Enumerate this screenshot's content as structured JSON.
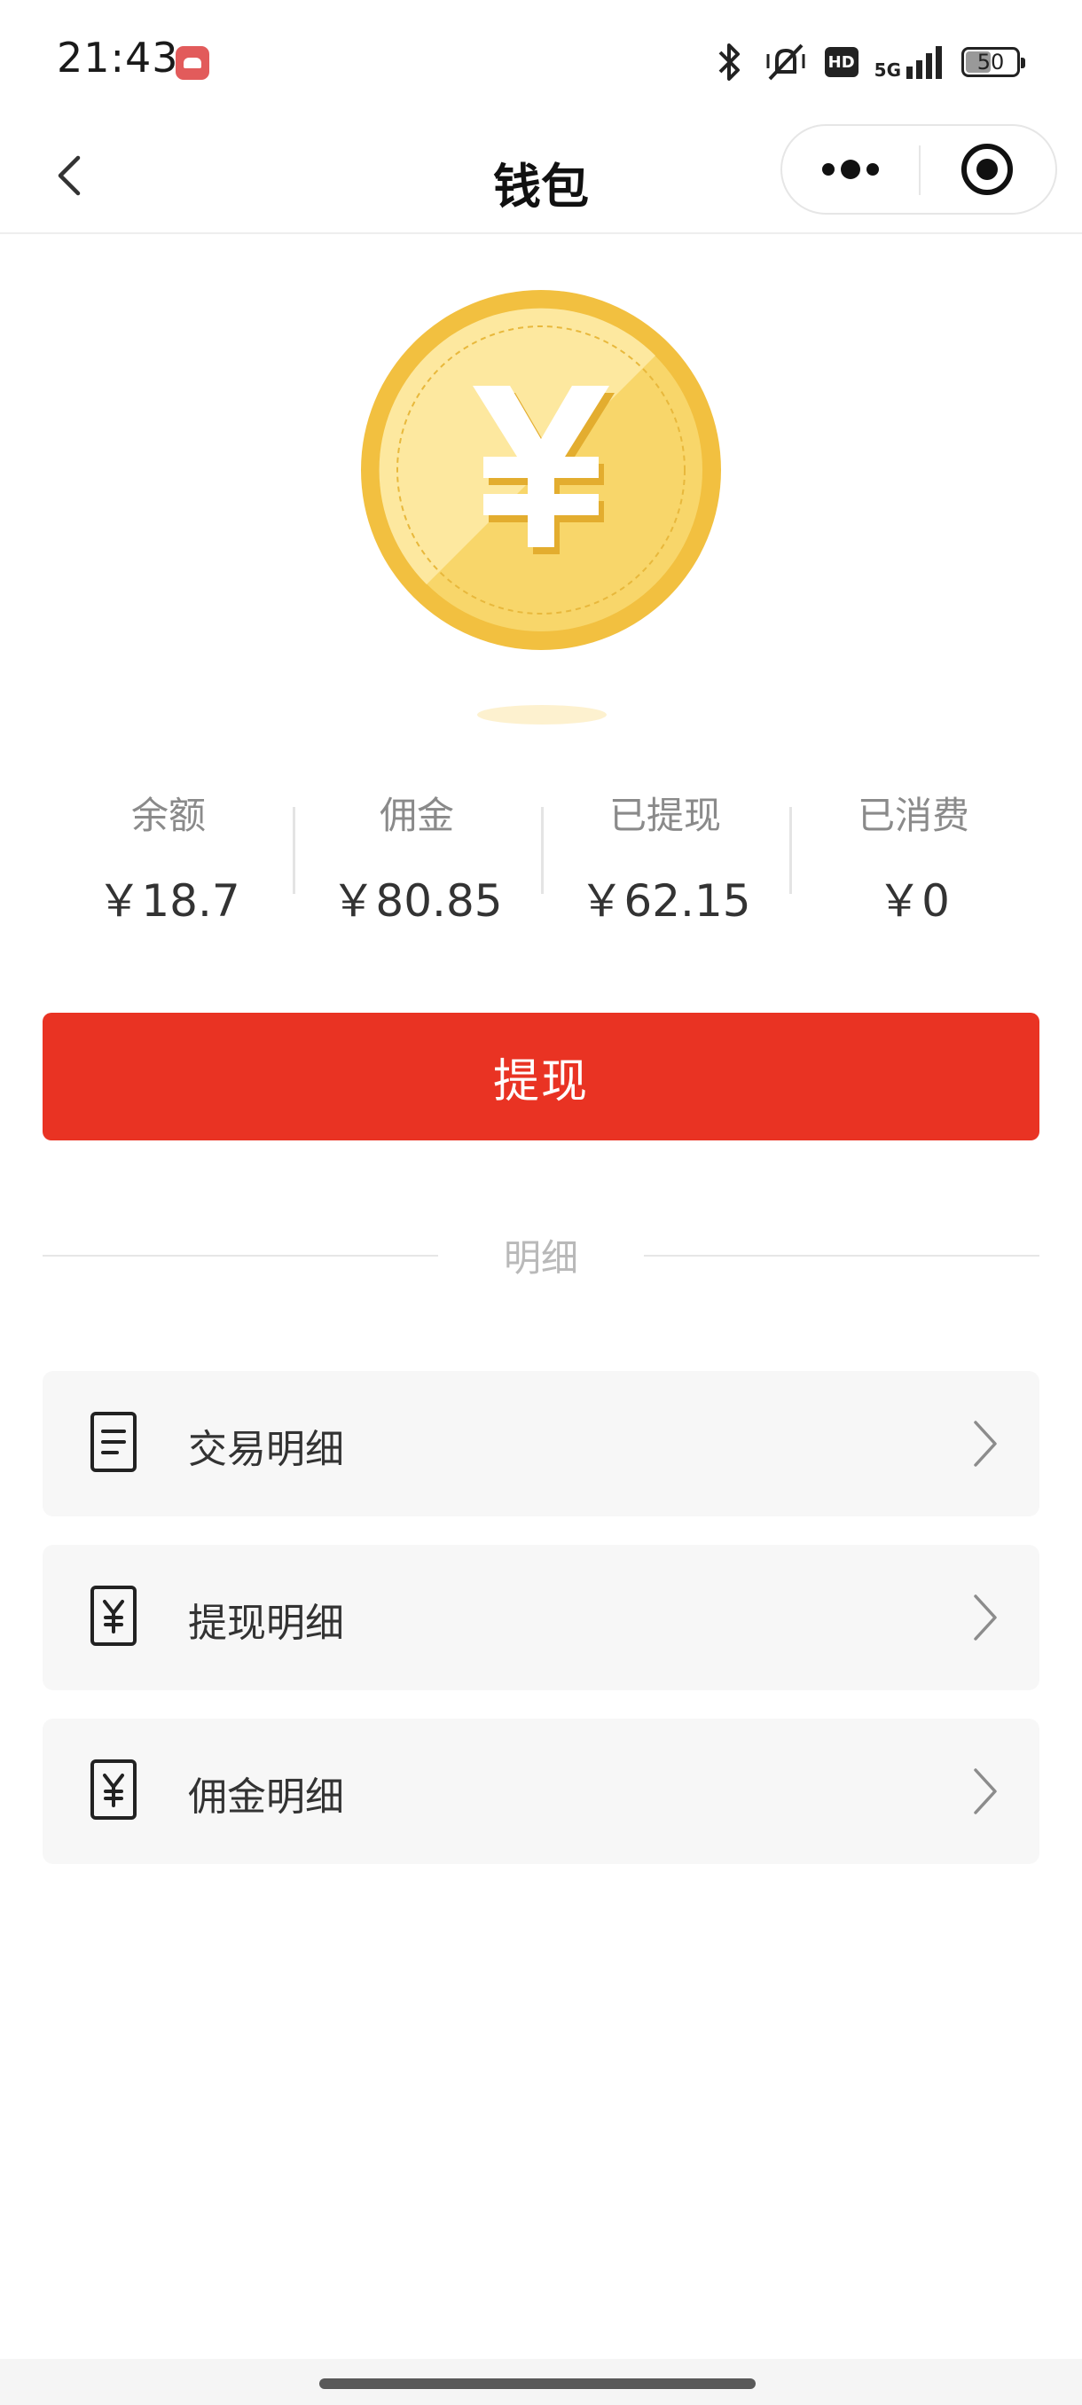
{
  "status_bar": {
    "time": "21:43",
    "network": "5G",
    "hd": "HD",
    "battery": "50",
    "battery_level": 0.5
  },
  "nav": {
    "title": "钱包"
  },
  "stats": [
    {
      "label": "余额",
      "value": "￥18.7"
    },
    {
      "label": "佣金",
      "value": "￥80.85"
    },
    {
      "label": "已提现",
      "value": "￥62.15"
    },
    {
      "label": "已消费",
      "value": "￥0"
    }
  ],
  "withdraw_button": {
    "label": "提现"
  },
  "section": {
    "title": "明细"
  },
  "details": [
    {
      "label": "交易明细",
      "icon": "document-icon"
    },
    {
      "label": "提现明细",
      "icon": "yen-receipt-icon"
    },
    {
      "label": "佣金明细",
      "icon": "yen-receipt-icon"
    }
  ],
  "colors": {
    "accent": "#e93323",
    "coin_gold": "#f2c040",
    "coin_light": "#fbe39a"
  }
}
